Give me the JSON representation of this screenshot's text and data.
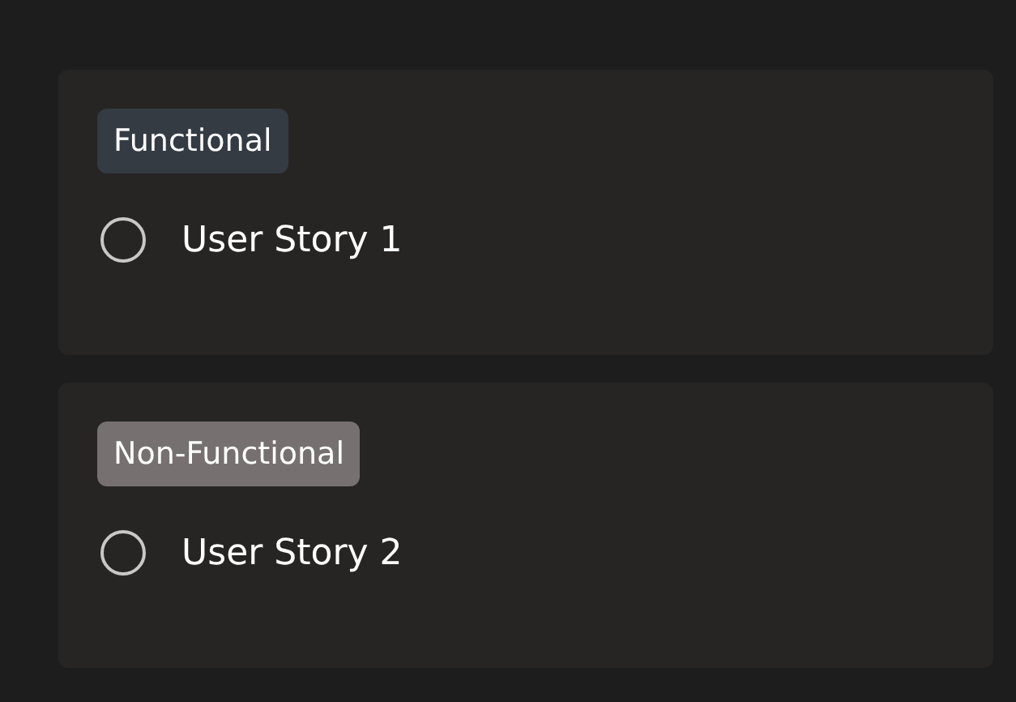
{
  "stories": [
    {
      "tag": {
        "label": "Functional",
        "color": "#343b42"
      },
      "title": "User Story 1",
      "checked": false
    },
    {
      "tag": {
        "label": "Non-Functional",
        "color": "#767170"
      },
      "title": "User Story 2",
      "checked": false
    }
  ]
}
